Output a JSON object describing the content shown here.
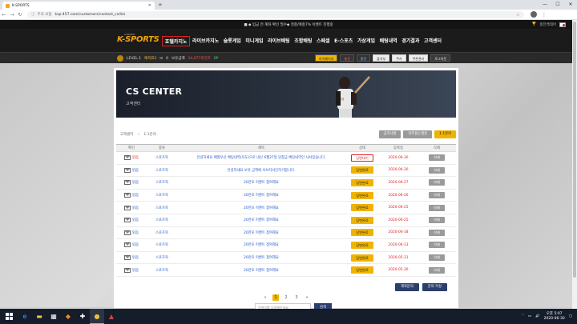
{
  "browser": {
    "tab_title": "K-SPORTS",
    "url_secure": "주의 요함",
    "url": "ksp-457.com/customers/contact_cs/list"
  },
  "site": {
    "notice": "■ ◆ 입금 전 계좌 확인 필수◆ 첫충/매충7% 이벤트 진행중",
    "cs_label": "충전백데어",
    "logo_text": "K-SPORTS",
    "logo_sub": "CARRIER",
    "nav": [
      "호텔카지노",
      "라이브카지노",
      "슬롯게임",
      "미니게임",
      "라이브배팅",
      "조합배팅",
      "스페셜",
      "E-스포츠",
      "가상게임",
      "배팅내역",
      "경기결과",
      "고객센터"
    ],
    "user": {
      "level": "LEVEL.1",
      "name": "예목표1",
      "msg_count": "0",
      "balance_label": "보유금액",
      "balance": "0",
      "point_label": "14,077포인트",
      "point": "0P"
    },
    "user_buttons": [
      "마이페이지",
      "충전",
      "환전",
      "출석부",
      "쿠키",
      "쿠폰관리",
      "로그아웃"
    ]
  },
  "cs": {
    "banner_title": "CS CENTER",
    "banner_sub": "고객센터",
    "breadcrumb": [
      "고객센터",
      "1:1문의"
    ],
    "top_buttons": [
      "공지사항",
      "자주묻는질문",
      "1:1문의"
    ],
    "columns": [
      "확인",
      "종류",
      "제목",
      "상태",
      "등록일",
      "삭제"
    ],
    "rows": [
      {
        "read": "읽음",
        "type": "스포츠북",
        "title": "안녕하세요 예절우선 베팅내역(자도)으로 내신 6월27일 당첨금 베팅내역인 사서있습니다.",
        "status": "답변대기",
        "date": "2020-06-30",
        "del": "삭제",
        "new": true
      },
      {
        "read": "읽음",
        "type": "스포츠북",
        "title": "안녕하세요 보유 금액에 서브자서인하기합니다.",
        "status": "답변완료",
        "date": "2020-06-30",
        "del": "삭제",
        "new": false
      },
      {
        "read": "읽음",
        "type": "스포츠북",
        "title": "20만포 이벤트 참여해요",
        "status": "답변완료",
        "date": "2020-06-27",
        "del": "삭제",
        "new": false
      },
      {
        "read": "읽음",
        "type": "스포츠북",
        "title": "20만포 이벤트 참여해요",
        "status": "답변완료",
        "date": "2020-06-26",
        "del": "삭제",
        "new": false
      },
      {
        "read": "읽음",
        "type": "스포츠북",
        "title": "20만포 이벤트 참여해요",
        "status": "답변완료",
        "date": "2020-06-25",
        "del": "삭제",
        "new": false
      },
      {
        "read": "읽음",
        "type": "스포츠북",
        "title": "20만포 이벤트 참여해요",
        "status": "답변완료",
        "date": "2020-06-25",
        "del": "삭제",
        "new": false
      },
      {
        "read": "읽음",
        "type": "스포츠북",
        "title": "20만포 이벤트 참여해요",
        "status": "답변완료",
        "date": "2020-06-18",
        "del": "삭제",
        "new": false
      },
      {
        "read": "읽음",
        "type": "스포츠북",
        "title": "20만포 이벤트 참여해요",
        "status": "답변완료",
        "date": "2020-06-13",
        "del": "삭제",
        "new": false
      },
      {
        "read": "읽음",
        "type": "스포츠북",
        "title": "20만포 이벤트 참여해요",
        "status": "답변완료",
        "date": "2020-05-31",
        "del": "삭제",
        "new": false
      },
      {
        "read": "읽음",
        "type": "스포츠북",
        "title": "20만포 이벤트 참여해요",
        "status": "답변완료",
        "date": "2020-05-30",
        "del": "삭제",
        "new": false
      }
    ],
    "action_buttons": [
      "계좌문의",
      "문의 작성"
    ],
    "pages": [
      "1",
      "2",
      "3"
    ],
    "page_prev": "«",
    "page_next": "»",
    "search_placeholder": "검색어를 입력해주세요",
    "search_button": "검색"
  },
  "taskbar": {
    "time": "오후 5:07",
    "date": "2020-06-30"
  }
}
